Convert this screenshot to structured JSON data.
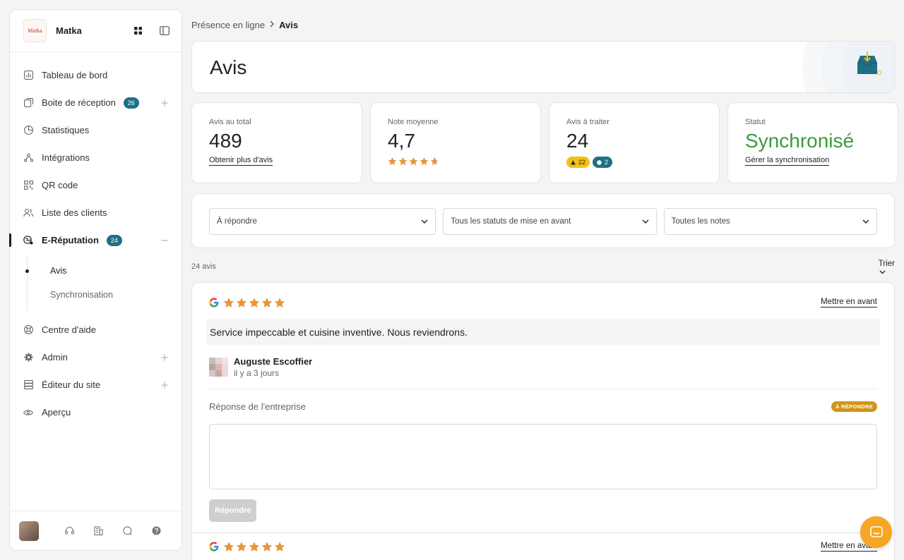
{
  "sidebar": {
    "logo_text": "Matka",
    "brand": "Matka",
    "items": [
      {
        "label": "Tableau de bord",
        "icon": "chart-bar-icon"
      },
      {
        "label": "Boite de réception",
        "icon": "inbox-icon",
        "badge": "26"
      },
      {
        "label": "Statistiques",
        "icon": "pie-chart-icon"
      },
      {
        "label": "Intégrations",
        "icon": "integrations-icon"
      },
      {
        "label": "QR code",
        "icon": "qr-code-icon"
      },
      {
        "label": "Liste des clients",
        "icon": "users-icon"
      },
      {
        "label": "E-Réputation",
        "icon": "reputation-icon",
        "badge": "24"
      },
      {
        "label": "Centre d'aide",
        "icon": "help-buoy-icon"
      },
      {
        "label": "Admin",
        "icon": "gear-icon"
      },
      {
        "label": "Éditeur du site",
        "icon": "site-editor-icon"
      },
      {
        "label": "Aperçu",
        "icon": "eye-icon"
      }
    ],
    "subitems": [
      {
        "label": "Avis"
      },
      {
        "label": "Synchronisation"
      }
    ]
  },
  "breadcrumb": {
    "parent": "Présence en ligne",
    "current": "Avis"
  },
  "page": {
    "title": "Avis"
  },
  "stats": {
    "total": {
      "label": "Avis au total",
      "value": "489",
      "link": "Obtenir plus d'avis"
    },
    "average": {
      "label": "Note moyenne",
      "value": "4,7",
      "rating": 4.7
    },
    "to_process": {
      "label": "Avis à traiter",
      "value": "24",
      "warn_count": "22",
      "info_count": "2"
    },
    "status": {
      "label": "Statut",
      "value": "Synchronisé",
      "link": "Gérer la synchronisation"
    }
  },
  "filters": {
    "reply_status": "À répondre",
    "highlight_status": "Tous les statuts de mise en avant",
    "rating": "Toutes les notes"
  },
  "list": {
    "count": "24 avis",
    "sort_label": "Trier"
  },
  "reviews": [
    {
      "source": "google-icon",
      "rating": 5,
      "action": "Mettre en avant",
      "text": "Service impeccable et cuisine inventive. Nous reviendrons.",
      "author": "Auguste Escoffier",
      "date": "il y a 3 jours",
      "reply_label": "Réponse de l'entreprise",
      "reply_badge": "À RÉPONDRE",
      "reply_button": "Répondre"
    },
    {
      "source": "google-icon",
      "rating": 5,
      "action": "Mettre en avant"
    }
  ],
  "colors": {
    "accent": "#1f6f86",
    "star": "#e8953a",
    "success": "#3e9a3c",
    "warning": "#d1951a",
    "chat": "#f5a623"
  }
}
